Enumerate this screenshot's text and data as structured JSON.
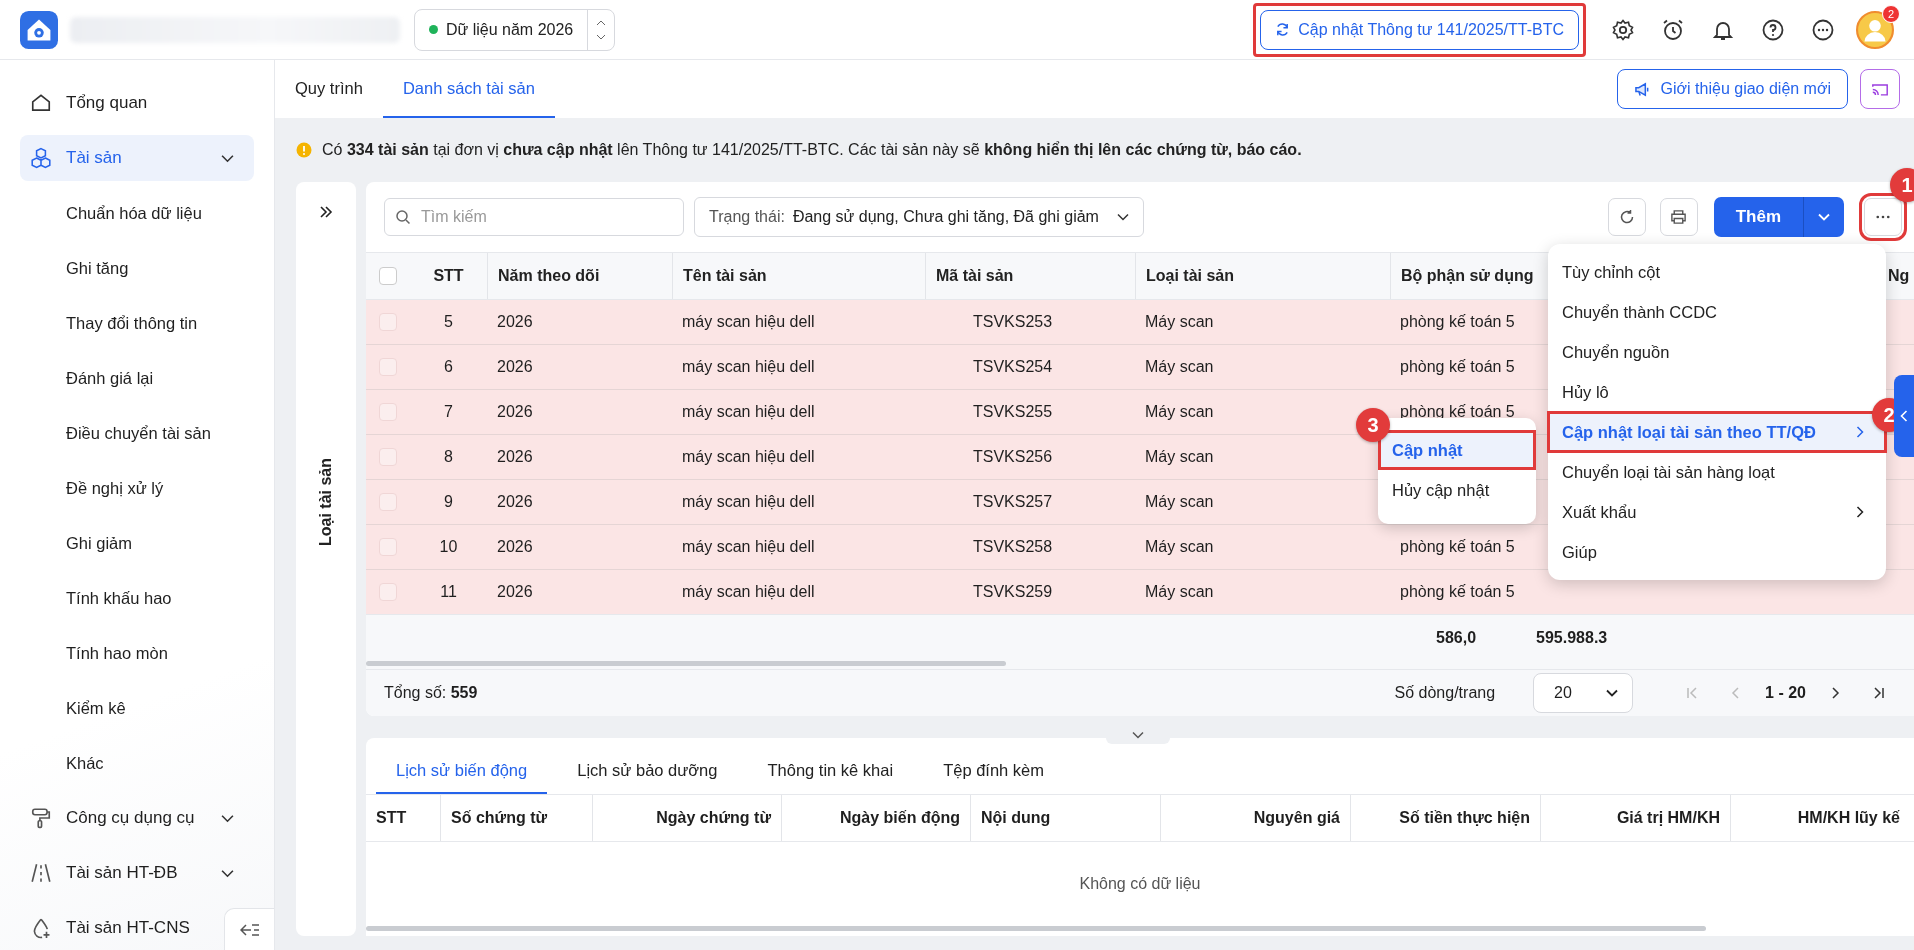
{
  "top_bar": {
    "year_selector": {
      "label": "Dữ liệu năm 2026"
    },
    "update_button": {
      "label": "Cập nhật Thông tư 141/2025/TT-BTC",
      "highlighted": true
    },
    "icons": [
      {
        "kind": "settings"
      },
      {
        "kind": "alarm"
      },
      {
        "kind": "bell"
      },
      {
        "kind": "help"
      },
      {
        "kind": "more"
      }
    ],
    "avatar": {
      "badge": "2"
    }
  },
  "sidebar": {
    "items": [
      {
        "label": "Tổng quan",
        "kind": "home",
        "selected": false
      },
      {
        "label": "Tài sản",
        "kind": "assets",
        "selected": true,
        "expandable": true,
        "expanded": true,
        "children": [
          {
            "label": "Chuẩn hóa dữ liệu"
          },
          {
            "label": "Ghi tăng"
          },
          {
            "label": "Thay đổi thông tin"
          },
          {
            "label": "Đánh giá lại"
          },
          {
            "label": "Điều chuyển tài sản"
          },
          {
            "label": "Đề nghị xử lý"
          },
          {
            "label": "Ghi giảm"
          },
          {
            "label": "Tính khấu hao"
          },
          {
            "label": "Tính hao mòn"
          },
          {
            "label": "Kiểm kê"
          },
          {
            "label": "Khác"
          }
        ]
      },
      {
        "label": "Công cụ dụng cụ",
        "kind": "tools",
        "selected": false,
        "expandable": true
      },
      {
        "label": "Tài sản HT-ĐB",
        "kind": "road",
        "selected": false,
        "expandable": true
      },
      {
        "label": "Tài sản HT-CNS",
        "kind": "water",
        "selected": false
      }
    ]
  },
  "tabs": [
    {
      "label": "Quy trình",
      "selected": false
    },
    {
      "label": "Danh sách tài sản",
      "selected": true
    }
  ],
  "intro_button": {
    "label": "Giới thiệu giao diện mới"
  },
  "notice": {
    "text": "Có **334 tài sản** tại đơn vị **chưa cập nhật** lên Thông tư 141/2025/TT-BTC. Các tài sản này sẽ **không hiển thị lên các chứng từ, báo cáo.**"
  },
  "side_panel": {
    "label": "Loại tài sản"
  },
  "toolbar": {
    "search": {
      "placeholder": "Tìm kiếm"
    },
    "filter": {
      "label": "Trạng thái:",
      "value": "Đang sử dụng, Chưa ghi tăng, Đã ghi giảm"
    },
    "add_button": {
      "label": "Thêm"
    },
    "more_button": {
      "highlighted": true,
      "callout": "1"
    }
  },
  "table": {
    "select_all_checked": false,
    "columns": [
      "STT",
      "Năm theo dõi",
      "Tên tài sản",
      "Mã tài sản",
      "Loại tài sản",
      "Bộ phận sử dụng",
      "Ng"
    ],
    "rows": [
      {
        "cells": [
          "5",
          "2026",
          "máy scan hiệu dell",
          "TSVKS253",
          "Máy scan",
          "phòng kế toán 5"
        ],
        "checked": false,
        "needs_update": true
      },
      {
        "cells": [
          "6",
          "2026",
          "máy scan hiệu dell",
          "TSVKS254",
          "Máy scan",
          "phòng kế toán 5"
        ],
        "checked": false,
        "needs_update": true
      },
      {
        "cells": [
          "7",
          "2026",
          "máy scan hiệu dell",
          "TSVKS255",
          "Máy scan",
          "phòng kế toán 5"
        ],
        "checked": false,
        "needs_update": true
      },
      {
        "cells": [
          "8",
          "2026",
          "máy scan hiệu dell",
          "TSVKS256",
          "Máy scan"
        ],
        "checked": false,
        "needs_update": true
      },
      {
        "cells": [
          "9",
          "2026",
          "máy scan hiệu dell",
          "TSVKS257",
          "Máy scan"
        ],
        "checked": false,
        "needs_update": true
      },
      {
        "cells": [
          "10",
          "2026",
          "máy scan hiệu dell",
          "TSVKS258",
          "Máy scan",
          "phòng kế toán 5"
        ],
        "checked": false,
        "needs_update": true
      },
      {
        "cells": [
          "11",
          "2026",
          "máy scan hiệu dell",
          "TSVKS259",
          "Máy scan",
          "phòng kế toán 5"
        ],
        "checked": false,
        "needs_update": true
      }
    ],
    "totals": [
      "586,0",
      "595.988.3"
    ]
  },
  "pager": {
    "total": "Tổng số: **559**",
    "page_size_label": "Số dòng/trang",
    "page_size": "20",
    "range": "1 - 20",
    "nav": [
      {
        "kind": "first",
        "disabled": true
      },
      {
        "kind": "prev",
        "disabled": true
      },
      {
        "kind": "next",
        "disabled": false
      },
      {
        "kind": "last",
        "disabled": false
      }
    ]
  },
  "menu": {
    "items": [
      {
        "label": "Tùy chỉnh cột",
        "selected": false,
        "submenu": false,
        "highlighted": false
      },
      {
        "label": "Chuyển thành CCDC",
        "selected": false,
        "submenu": false,
        "highlighted": false
      },
      {
        "label": "Chuyển nguồn",
        "selected": false,
        "submenu": false,
        "highlighted": false
      },
      {
        "label": "Hủy lô",
        "selected": false,
        "submenu": false,
        "highlighted": false
      },
      {
        "label": "Cập nhật loại tài sản theo TT/QĐ",
        "selected": true,
        "submenu": true,
        "highlighted": true,
        "callout": "2"
      },
      {
        "label": "Chuyển loại tài sản hàng loạt",
        "selected": false,
        "submenu": false,
        "highlighted": false
      },
      {
        "label": "Xuất khẩu",
        "selected": false,
        "submenu": true,
        "highlighted": false
      },
      {
        "label": "Giúp",
        "selected": false,
        "submenu": false,
        "highlighted": false
      }
    ]
  },
  "submenu": {
    "items": [
      {
        "label": "Cập nhật",
        "selected": true,
        "highlighted": true,
        "callout": "3"
      },
      {
        "label": "Hủy cập nhật",
        "selected": false,
        "highlighted": false
      }
    ]
  },
  "detail": {
    "tabs": [
      {
        "label": "Lịch sử biến động",
        "selected": true
      },
      {
        "label": "Lịch sử bảo dưỡng",
        "selected": false
      },
      {
        "label": "Thông tin kê khai",
        "selected": false
      },
      {
        "label": "Tệp đính kèm",
        "selected": false
      }
    ],
    "columns": [
      "STT",
      "Số chứng từ",
      "Ngày chứng từ",
      "Ngày biến động",
      "Nội dung",
      "Nguyên giá",
      "Số tiền thực hiện",
      "Giá trị HM/KH",
      "HM/KH lũy kế"
    ],
    "empty": "Không có dữ liệu"
  }
}
